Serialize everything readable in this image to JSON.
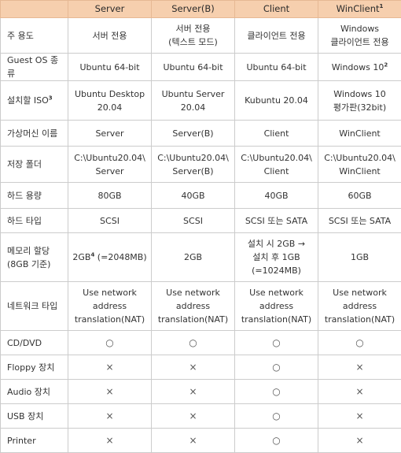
{
  "header": {
    "col1": "Server",
    "col2": "Server(B)",
    "col3": "Client",
    "col4": "WinClient",
    "col4_sup": "1"
  },
  "rows": [
    {
      "label": "주 용도",
      "cells": [
        "서버 전용",
        "서버 전용\n(텍스트 모드)",
        "클라이언트 전용",
        "Windows\n클라이언트 전용"
      ]
    },
    {
      "label": "Guest OS 종류",
      "cells": [
        "Ubuntu 64-bit",
        "Ubuntu 64-bit",
        "Ubuntu 64-bit",
        "Windows 10"
      ],
      "cell4_sup": "2"
    },
    {
      "label": "설치할 ISO",
      "label_sup": "3",
      "cells": [
        "Ubuntu Desktop\n20.04",
        "Ubuntu Server\n20.04",
        "Kubuntu 20.04",
        "Windows 10\n평가판(32bit)"
      ]
    },
    {
      "label": "가상머신 이름",
      "cells": [
        "Server",
        "Server(B)",
        "Client",
        "WinClient"
      ]
    },
    {
      "label": "저장 폴더",
      "cells": [
        "C:\\Ubuntu20.04\\\nServer",
        "C:\\Ubuntu20.04\\\nServer(B)",
        "C:\\Ubuntu20.04\\\nClient",
        "C:\\Ubuntu20.04\\\nWinClient"
      ]
    },
    {
      "label": "하드 용량",
      "cells": [
        "80GB",
        "40GB",
        "40GB",
        "60GB"
      ]
    },
    {
      "label": "하드 타입",
      "cells": [
        "SCSI",
        "SCSI",
        "SCSI 또는 SATA",
        "SCSI 또는 SATA"
      ]
    },
    {
      "label": "메모리 할당\n(8GB 기준)",
      "cells": [
        "2GB",
        "2GB",
        "설치 시 2GB →\n설치 후 1GB\n(=1024MB)",
        "1GB"
      ],
      "cell1_sup": "4",
      "cell1_suffix": " (=2048MB)"
    },
    {
      "label": "네트워크 타입",
      "cells": [
        "Use network\naddress\ntranslation(NAT)",
        "Use network\naddress\ntranslation(NAT)",
        "Use network\naddress\ntranslation(NAT)",
        "Use network\naddress\ntranslation(NAT)"
      ]
    },
    {
      "label": "CD/DVD",
      "cells": [
        "○",
        "○",
        "○",
        "○"
      ]
    },
    {
      "label": "Floppy 장치",
      "cells": [
        "×",
        "×",
        "○",
        "×"
      ]
    },
    {
      "label": "Audio 장치",
      "cells": [
        "×",
        "×",
        "○",
        "×"
      ]
    },
    {
      "label": "USB 장치",
      "cells": [
        "×",
        "×",
        "○",
        "×"
      ]
    },
    {
      "label": "Printer",
      "cells": [
        "×",
        "×",
        "○",
        "×"
      ]
    }
  ]
}
